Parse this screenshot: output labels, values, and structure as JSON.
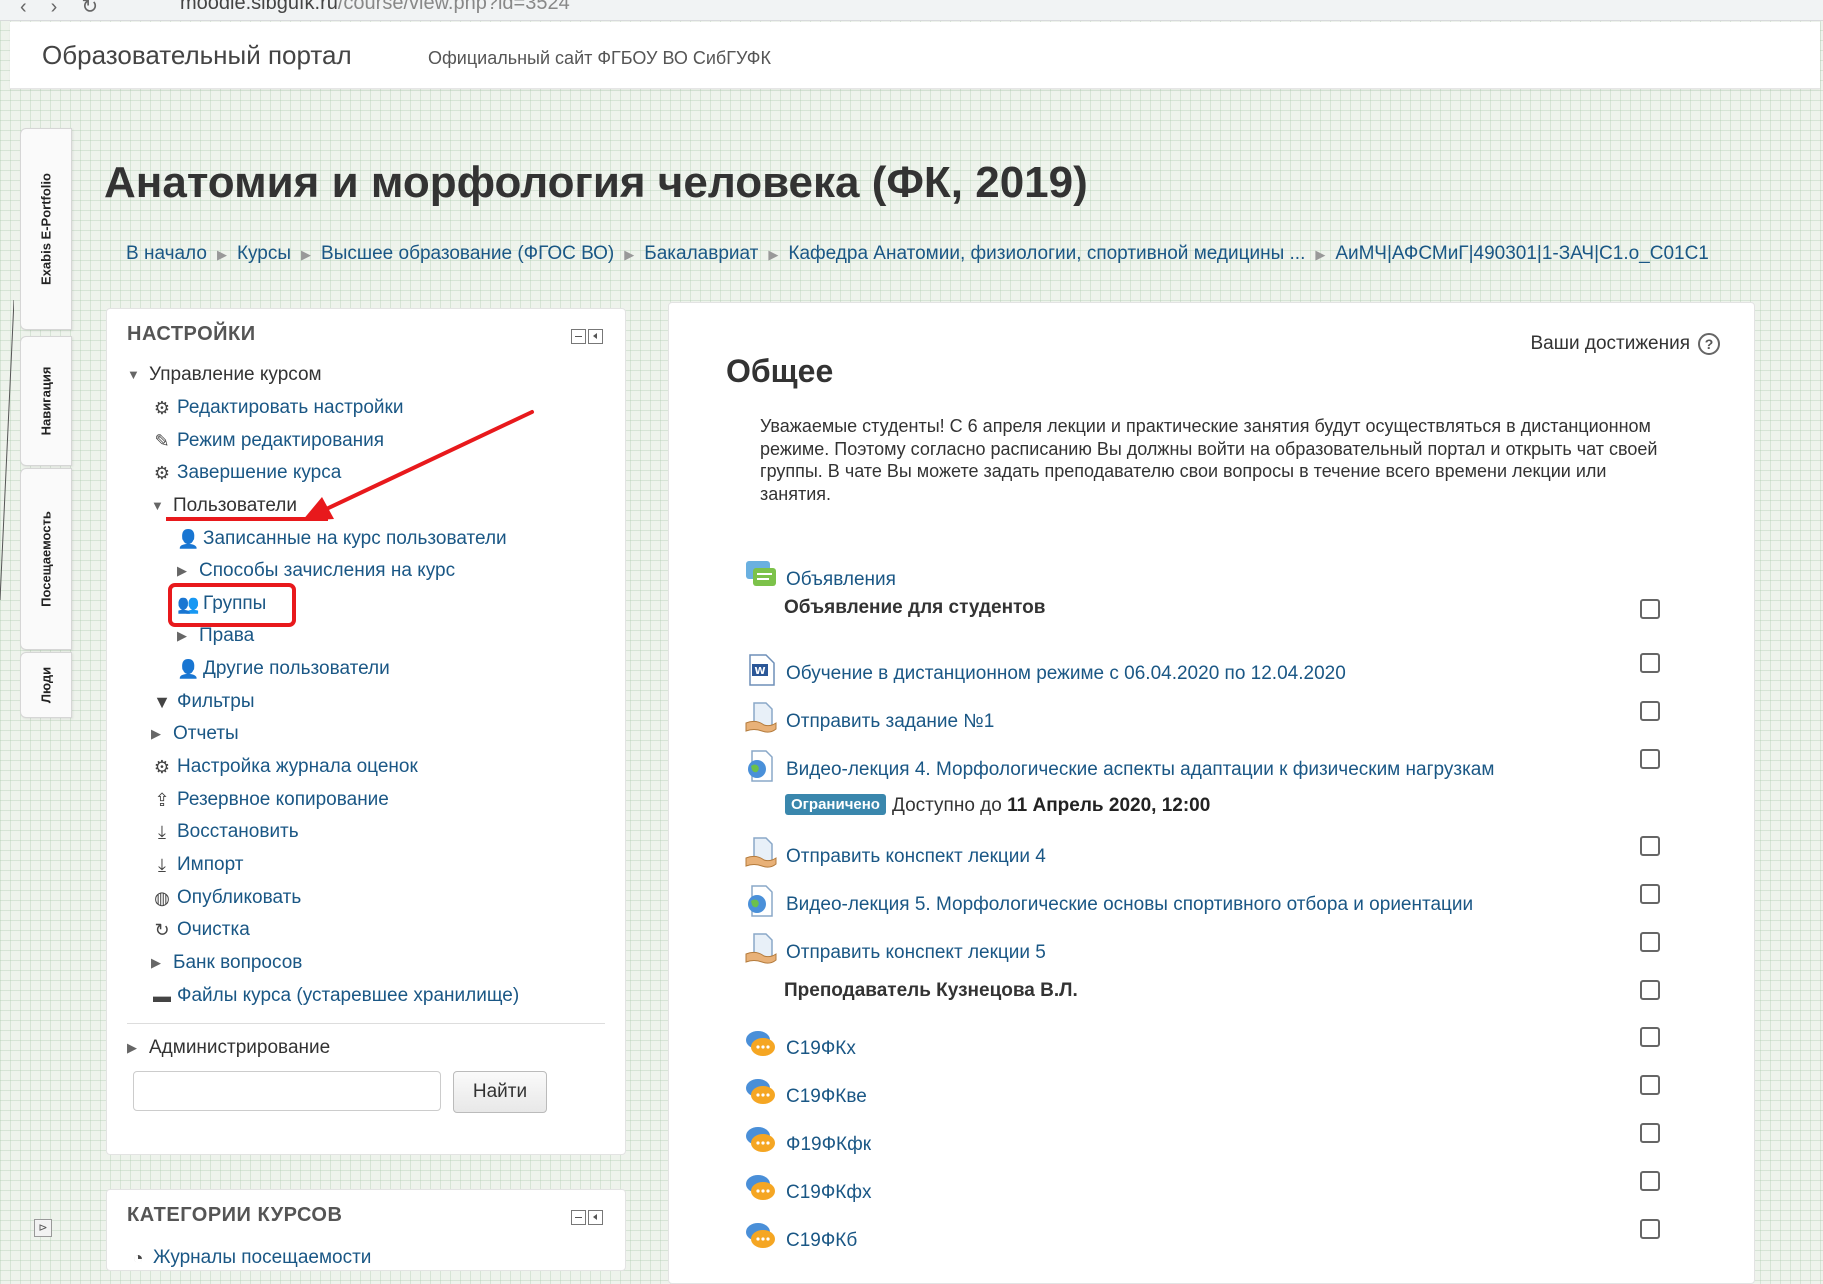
{
  "browser": {
    "url_host": "moodle.sibgufk.ru",
    "url_path": "/course/view.php?id=3524"
  },
  "navbar": {
    "brand": "Образовательный портал",
    "tagline": "Официальный сайт ФГБОУ ВО СибГУФК"
  },
  "side_tabs": [
    "Exabis E-Portfolio",
    "Навигация",
    "Посещаемость",
    "Люди"
  ],
  "dock_expand": "⊳",
  "page": {
    "title": "Анатомия и морфология человека (ФК, 2019)",
    "breadcrumb": [
      "В начало",
      "Курсы",
      "Высшее образование (ФГОС ВО)",
      "Бакалавриат",
      "Кафедра Анатомии, физиологии, спортивной медицины ...",
      "АиМЧ|АФСМиГ|490301|1-ЗАЧ|С1.о_С01С1"
    ]
  },
  "settings": {
    "title": "НАСТРОЙКИ",
    "course_admin": "Управление курсом",
    "items": {
      "edit_settings": "Редактировать настройки",
      "edit_mode": "Режим редактирования",
      "completion": "Завершение курса",
      "users": "Пользователи",
      "enrolled_users": "Записанные на курс пользователи",
      "enrol_methods": "Способы зачисления на курс",
      "groups": "Группы",
      "permissions": "Права",
      "other_users": "Другие пользователи",
      "filters": "Фильтры",
      "reports": "Отчеты",
      "gradebook_setup": "Настройка журнала оценок",
      "backup": "Резервное копирование",
      "restore": "Восстановить",
      "import": "Импорт",
      "publish": "Опубликовать",
      "reset": "Очистка",
      "question_bank": "Банк вопросов",
      "legacy_files": "Файлы курса (устаревшее хранилище)"
    },
    "site_admin": "Администрирование",
    "search_value": "",
    "search_button": "Найти"
  },
  "categories": {
    "title": "КАТЕГОРИИ КУРСОВ",
    "first_item": "Журналы посещаемости"
  },
  "main": {
    "achievements": "Ваши достижения",
    "help_icon": "?",
    "section_title": "Общее",
    "section_summary": "Уважаемые студенты!    С 6 апреля  лекции и практические занятия будут осуществляться в дистанционном режиме. Поэтому согласно расписанию Вы должны войти на образовательный портал и  открыть чат своей группы. В чате Вы можете задать преподавателю свои вопросы в течение всего времени лекции или занятия.",
    "forum": "Объявления",
    "label_students": "Объявление для студентов",
    "activities": {
      "distance_doc": "Обучение в дистанционном режиме с 06.04.2020 по 12.04.2020",
      "assign1": "Отправить задание №1",
      "video4": "Видео-лекция 4. Морфологические аспекты адаптации к физическим нагрузкам",
      "notes4": "Отправить конспект лекции 4",
      "video5": "Видео-лекция 5. Морфологические основы спортивного отбора и ориентации",
      "notes5": "Отправить конспект лекции 5"
    },
    "restriction": {
      "badge": "Ограничено",
      "text": "Доступно до",
      "date": "11 Апрель 2020, 12:00"
    },
    "label_teacher": "Преподаватель Кузнецова В.Л.",
    "chats": [
      "С19ФКх",
      "С19ФКве",
      "Ф19ФКфк",
      "С19ФКфх",
      "С19ФКб"
    ]
  },
  "colors": {
    "link": "#1a5785",
    "annotation_red": "#e8191c",
    "badge": "#3a87ad",
    "page_bg": "#eef3ec"
  }
}
